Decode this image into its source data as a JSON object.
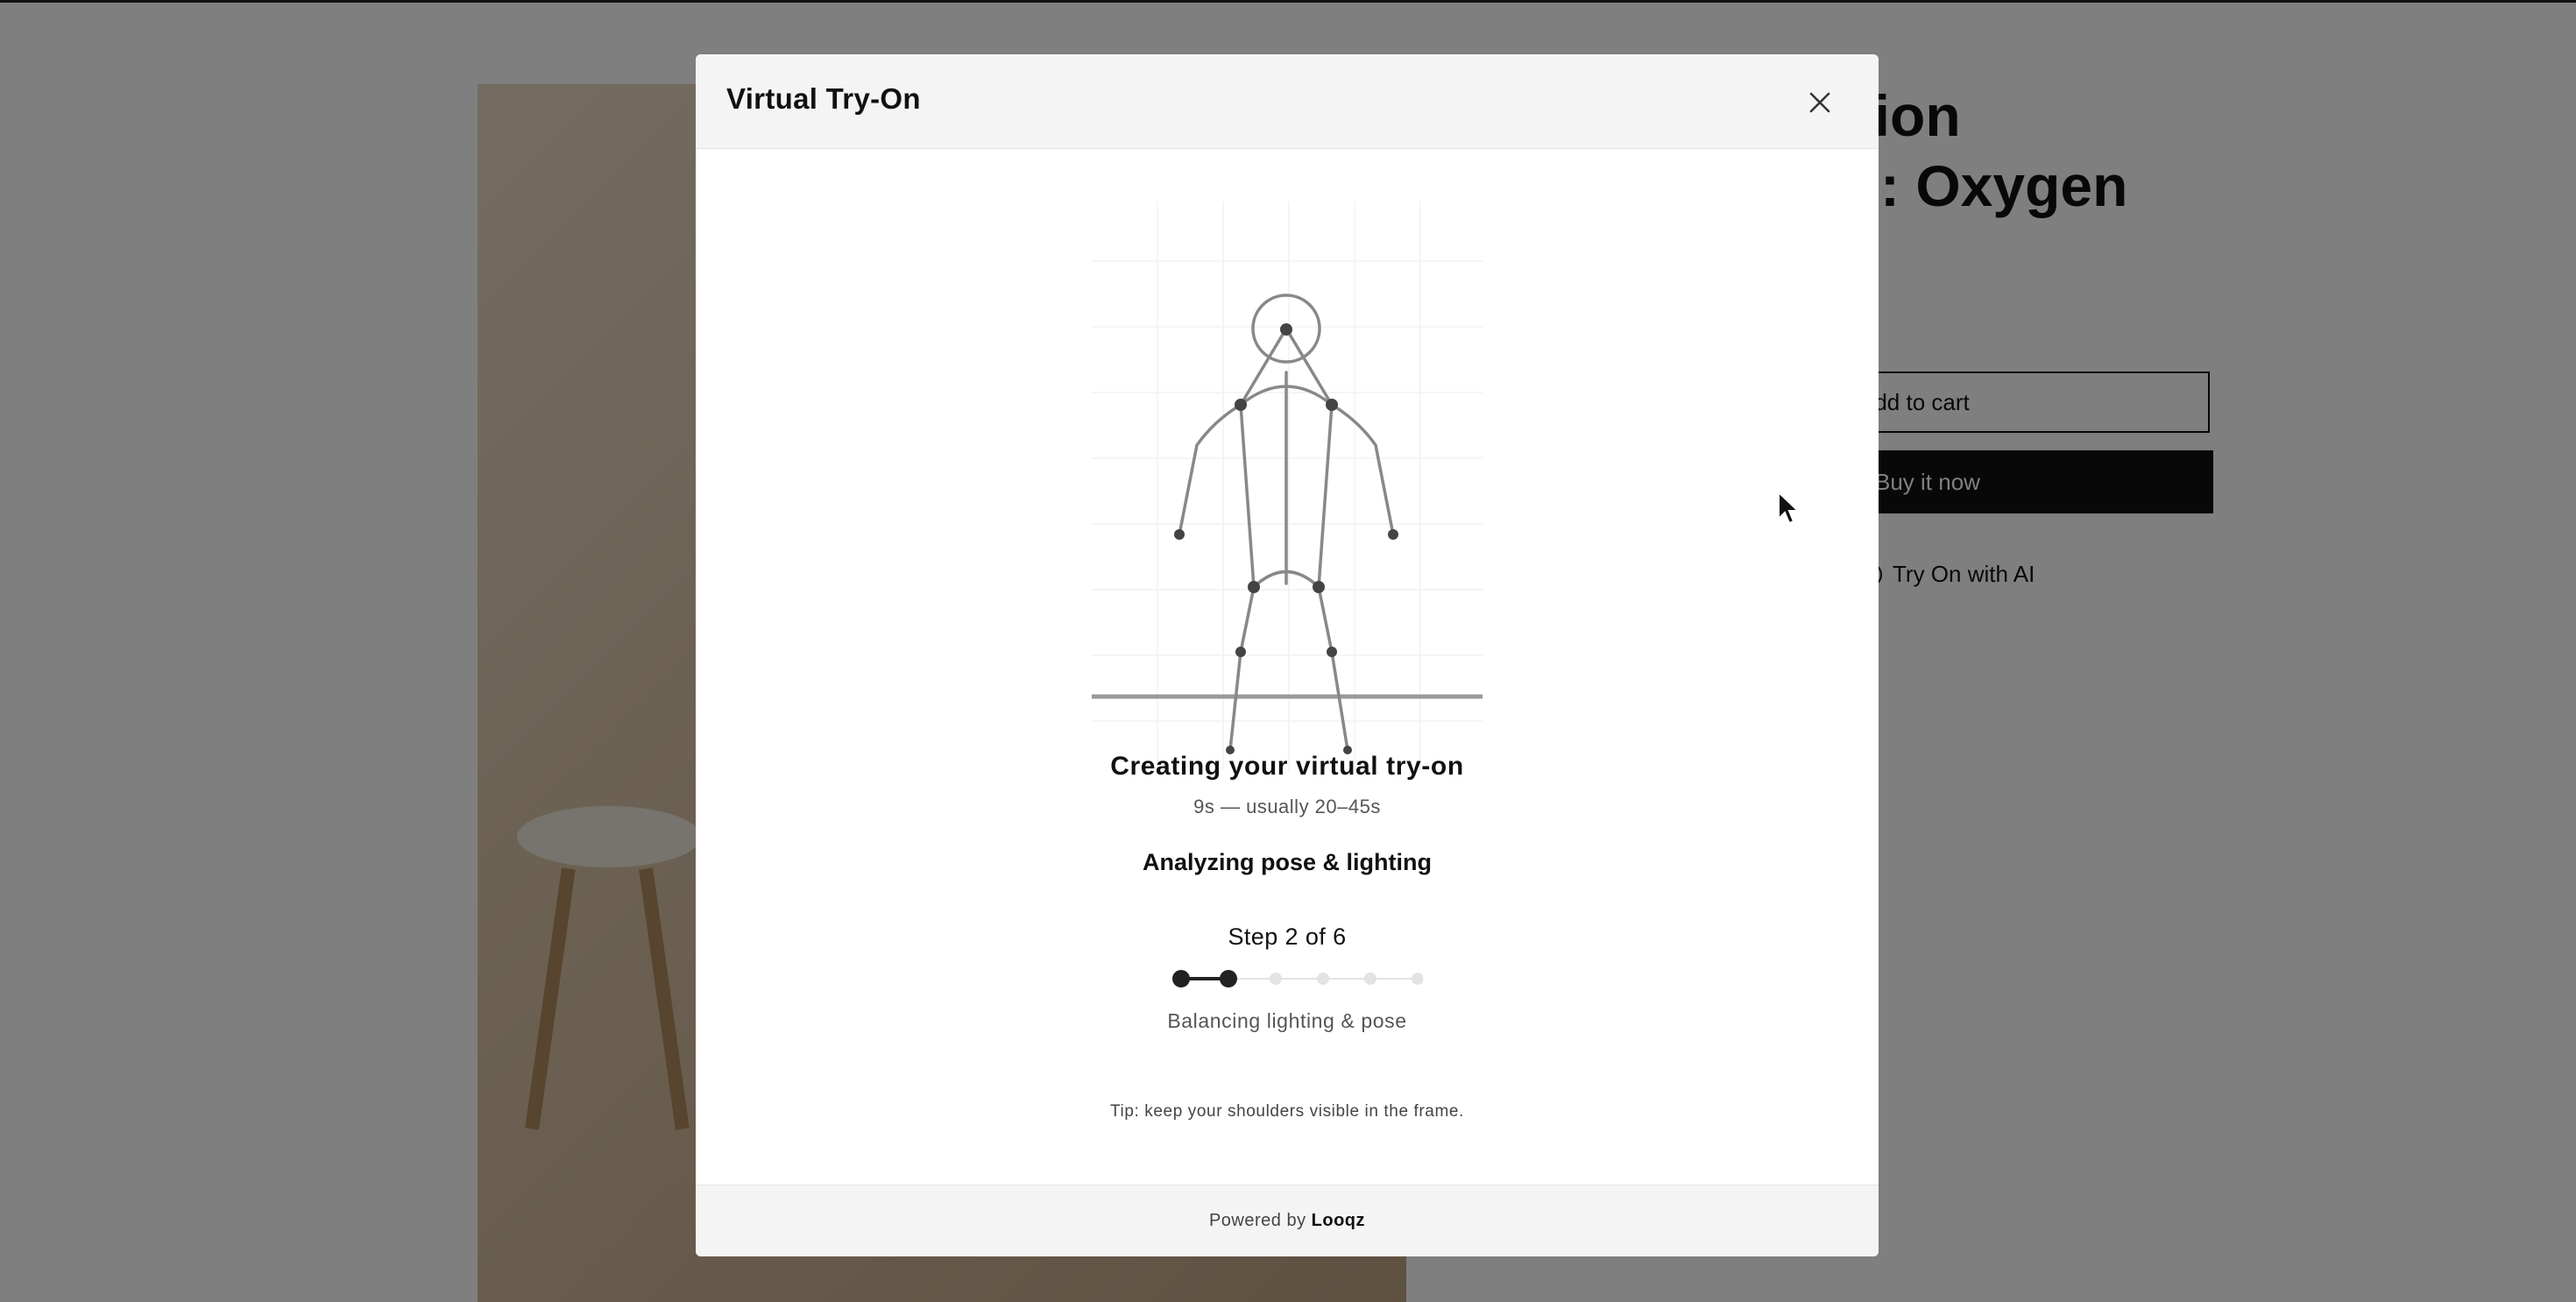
{
  "background_page": {
    "product_title_line1": "ction",
    "product_title_line2": "rd: Oxygen",
    "add_to_cart_label": "Add to cart",
    "buy_now_label": "Buy it now",
    "try_on_label": "Try On with AI"
  },
  "modal": {
    "title": "Virtual Try-On",
    "close_icon": "close-icon",
    "headline": "Creating your virtual try-on",
    "elapsed": "9s — usually 20–45s",
    "phase": "Analyzing pose & lighting",
    "step_text": "Step 2 of 6",
    "progress": {
      "current_step": 2,
      "total_steps": 6
    },
    "step_label": "Balancing lighting & pose",
    "tip": "Tip: keep your shoulders visible in the frame.",
    "footer": {
      "powered_by": "Powered by",
      "brand": "Looqz"
    }
  },
  "colors": {
    "accent": "#222222",
    "inactive_dot": "#e3e3e3",
    "overlay": "#808080"
  }
}
